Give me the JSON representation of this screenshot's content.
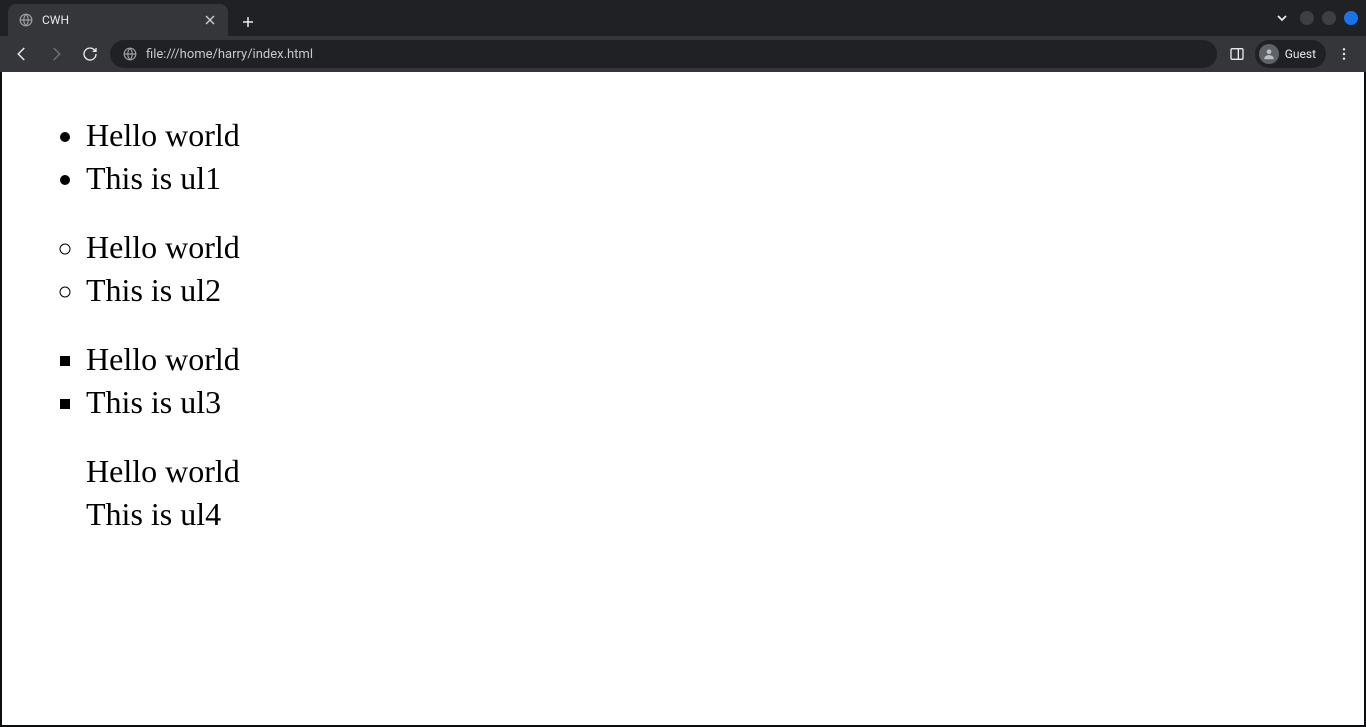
{
  "tab": {
    "title": "CWH"
  },
  "toolbar": {
    "url": "file:///home/harry/index.html",
    "profile_label": "Guest"
  },
  "page": {
    "ul1": {
      "item1": "Hello world",
      "item2": "This is ul1"
    },
    "ul2": {
      "item1": "Hello world",
      "item2": "This is ul2"
    },
    "ul3": {
      "item1": "Hello world",
      "item2": "This is ul3"
    },
    "ul4": {
      "item1": "Hello world",
      "item2": "This is ul4"
    }
  }
}
